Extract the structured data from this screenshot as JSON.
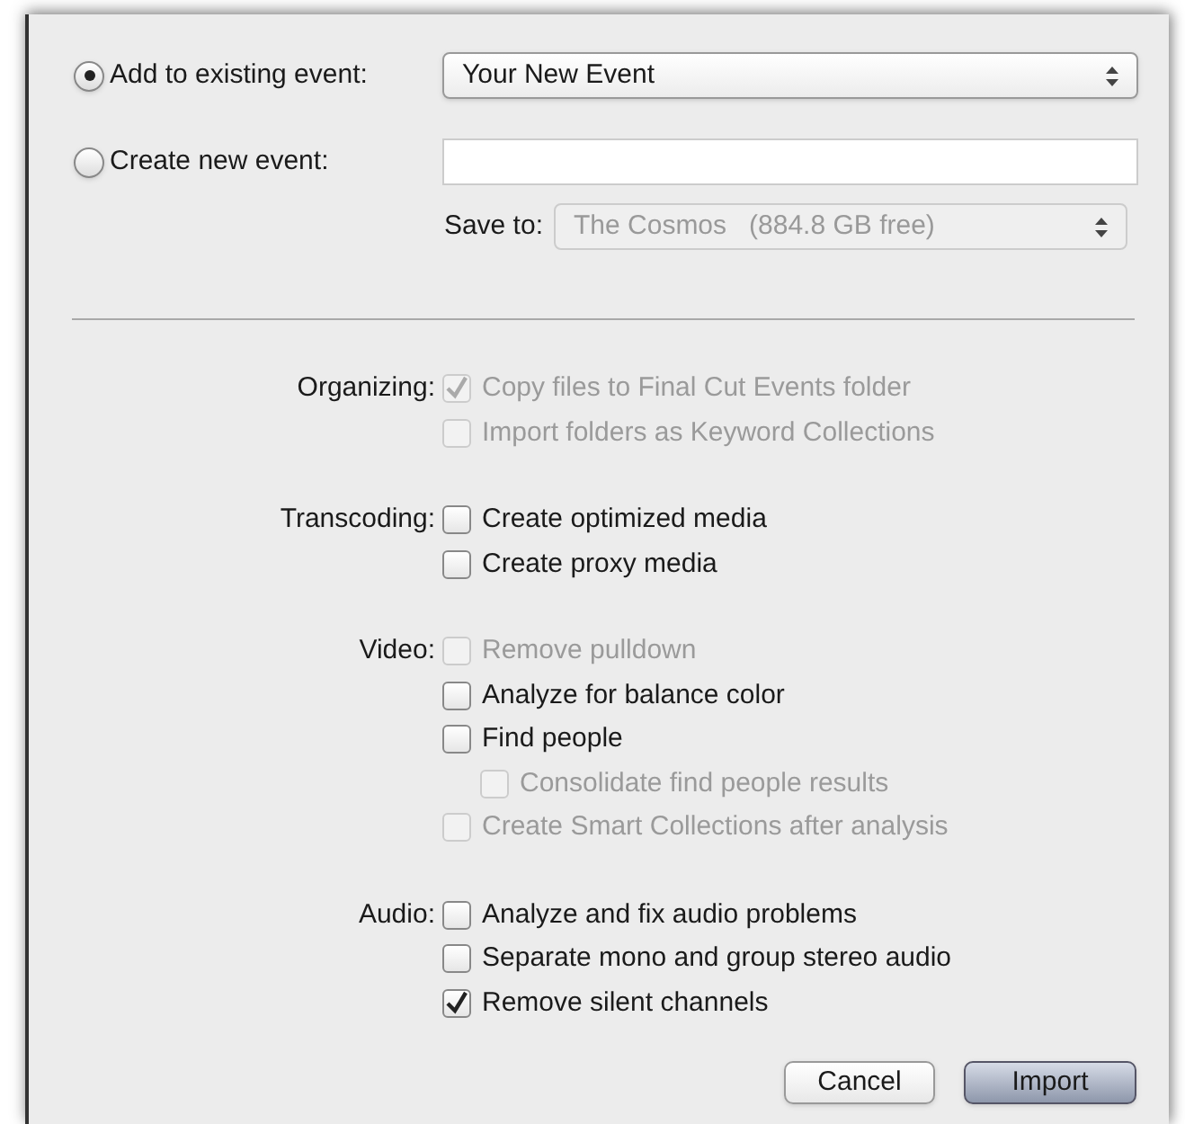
{
  "event_choice": [
    {
      "label": "Add to existing event:",
      "selected": true
    },
    {
      "label": "Create new event:",
      "selected": false
    }
  ],
  "existing_event_select": {
    "value": "Your New Event"
  },
  "save_to": {
    "label": "Save to:",
    "value": "The Cosmos   (884.8 GB free)",
    "disabled": true
  },
  "sections": [
    {
      "label": "Organizing:",
      "options": [
        {
          "label": "Copy files to Final Cut Events folder",
          "checked": true,
          "disabled": true
        },
        {
          "label": "Import folders as Keyword Collections",
          "checked": false,
          "disabled": true
        }
      ]
    },
    {
      "label": "Transcoding:",
      "options": [
        {
          "label": "Create optimized media",
          "checked": false,
          "disabled": false
        },
        {
          "label": "Create proxy media",
          "checked": false,
          "disabled": false
        }
      ]
    },
    {
      "label": "Video:",
      "options": [
        {
          "label": "Remove pulldown",
          "checked": false,
          "disabled": true
        },
        {
          "label": "Analyze for balance color",
          "checked": false,
          "disabled": false
        },
        {
          "label": "Find people",
          "checked": false,
          "disabled": false,
          "children": [
            {
              "label": "Consolidate find people results",
              "checked": false,
              "disabled": true
            }
          ]
        },
        {
          "label": "Create Smart Collections after analysis",
          "checked": false,
          "disabled": true
        }
      ]
    },
    {
      "label": "Audio:",
      "options": [
        {
          "label": "Analyze and fix audio problems",
          "checked": false,
          "disabled": false
        },
        {
          "label": "Separate mono and group stereo audio",
          "checked": false,
          "disabled": false
        },
        {
          "label": "Remove silent channels",
          "checked": true,
          "disabled": false
        }
      ]
    }
  ],
  "buttons": [
    {
      "label": "Cancel",
      "default": false
    },
    {
      "label": "Import",
      "default": true
    }
  ]
}
